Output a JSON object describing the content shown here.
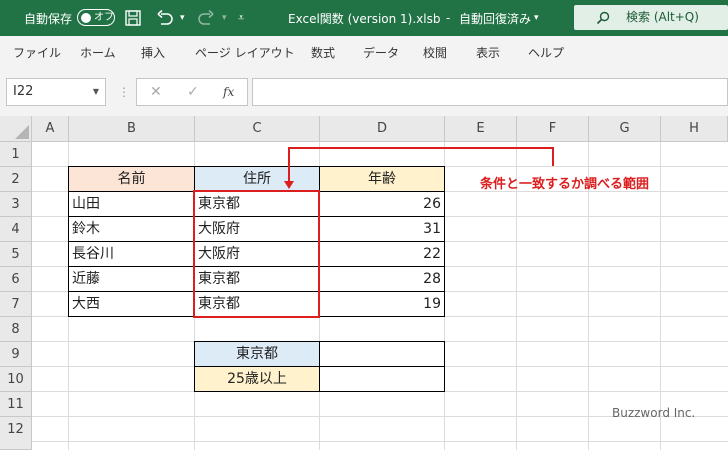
{
  "titlebar": {
    "autosave_label": "自動保存",
    "autosave_state": "オフ",
    "title": "Excel関数 (version 1).xlsb",
    "save_status": "自動回復済み",
    "search_label": "検索 (Alt+Q)"
  },
  "ribbon": {
    "tabs": [
      "ファイル",
      "ホーム",
      "挿入",
      "ページ レイアウト",
      "数式",
      "データ",
      "校閲",
      "表示",
      "ヘルプ"
    ]
  },
  "formula_bar": {
    "name_box": "I22",
    "cancel_symbol": "✕",
    "enter_symbol": "✓",
    "fx_symbol": "fx",
    "formula": ""
  },
  "sheet": {
    "columns": [
      "A",
      "B",
      "C",
      "D",
      "E",
      "F",
      "G",
      "H"
    ],
    "rows": [
      "1",
      "2",
      "3",
      "4",
      "5",
      "6",
      "7",
      "8",
      "9",
      "10",
      "11",
      "12"
    ],
    "table": {
      "headers": [
        "名前",
        "住所",
        "年齢"
      ],
      "rows": [
        [
          "山田",
          "東京都",
          "26"
        ],
        [
          "鈴木",
          "大阪府",
          "31"
        ],
        [
          "長谷川",
          "大阪府",
          "22"
        ],
        [
          "近藤",
          "東京都",
          "28"
        ],
        [
          "大西",
          "東京都",
          "19"
        ]
      ]
    },
    "criteria": {
      "address": "東京都",
      "age": "25歳以上",
      "address_result": "",
      "age_result": ""
    },
    "callout": "条件と一致するか調べる範囲",
    "watermark": "Buzzword Inc."
  },
  "colors": {
    "title_green": "#217346",
    "header_orange": "#fce4d6",
    "header_blue": "#ddebf7",
    "header_yellow": "#fff2cc",
    "highlight_red": "#dc1e1e"
  }
}
